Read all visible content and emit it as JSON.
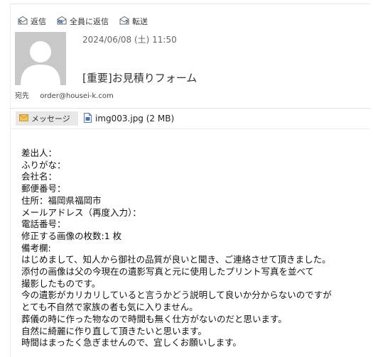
{
  "toolbar": {
    "reply_label": "返信",
    "reply_all_label": "全員に返信",
    "forward_label": "転送"
  },
  "header": {
    "date": "2024/06/08 (土) 11:50",
    "subject": "[重要]お見積りフォーム",
    "to_label": "宛先",
    "to_address": "order@housei-k.com"
  },
  "tabs": {
    "message_label": "メッセージ",
    "attachment_label": "img003.jpg (2 MB)"
  },
  "body_lines": [
    "差出人：",
    "ふりがな：",
    "会社名：",
    "郵便番号：",
    "住所：福岡県福岡市",
    "メールアドレス（再度入力）：",
    "電話番号：",
    "修正する画像の枚数:1 枚",
    "備考欄:",
    "はじめまして、知人から御社の品質が良いと聞き、ご連絡させて頂きました。",
    "添付の画像は父の今現在の遺影写真と元に使用したプリント写真を並べて",
    "撮影したものです。",
    "今の遺影がカリカリしていると言うかどう説明して良いか分からないのですが",
    "とても不自然で家族の者も気に入りません。",
    "葬儀の時に作った物なので時間も無く仕方がないのだと思います。",
    "自然に綺麗に作り直して頂きたいと思います。",
    "時間はまったく急ぎませんので、宜しくお願いします。"
  ]
}
